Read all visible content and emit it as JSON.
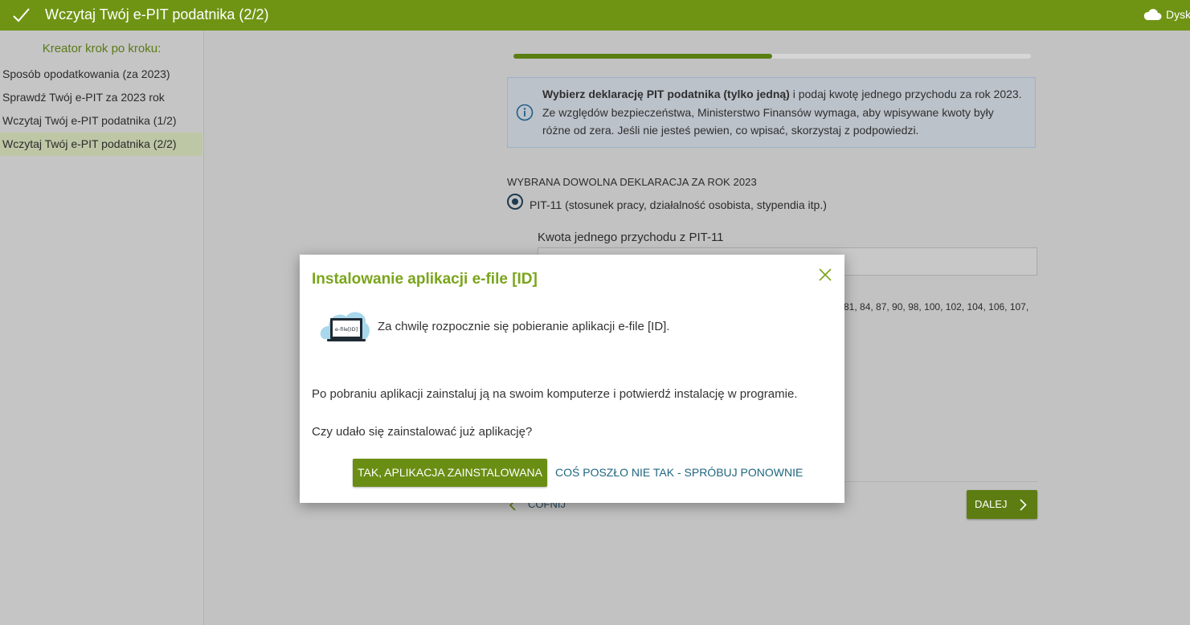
{
  "header": {
    "title": "Wczytaj Twój e-PIT podatnika (2/2)",
    "cloud_label": "Dysk",
    "check_icon": "checkmark-icon",
    "cloud_icon": "cloud-icon"
  },
  "sidebar": {
    "heading": "Kreator krok po kroku:",
    "items": [
      {
        "label": "Sposób opodatkowania (za 2023)"
      },
      {
        "label": "Sprawdź Twój e-PIT za 2023 rok"
      },
      {
        "label": "Wczytaj Twój e-PIT podatnika (1/2)"
      },
      {
        "label": "Wczytaj Twój e-PIT podatnika (2/2)",
        "active": true
      }
    ]
  },
  "main": {
    "progress": 0.5,
    "info": {
      "bold": "Wybierz deklarację PIT podatnika (tylko jedną)",
      "rest": " i podaj kwotę jednego przychodu za rok 2023. Ze względów bezpieczeństwa, Ministerstwo Finansów wymaga, aby wpisywane kwoty były różne od zera. Jeśli nie jesteś pewien, co wpisać, skorzystaj z podpowiedzi."
    },
    "section_label": "WYBRANA DOWOLNA DEKLARACJA ZA ROK 2023",
    "radio_label": "PIT-11 (stosunek pracy, działalność osobista, stypendia itp.)",
    "field_label": "Kwota jednego przychodu z PIT-11",
    "field_value": "",
    "hint_tail": "81, 84, 87, 90, 98, 100, 102, 104, 106, 107,",
    "back_label": "COFNIJ",
    "next_label": "DALEJ"
  },
  "modal": {
    "title": "Instalowanie aplikacji e-file [ID]",
    "line1": "Za chwilę rozpocznie się pobieranie aplikacji e-file [ID].",
    "line2": "Po pobraniu aplikacji zainstaluj ją na swoim komputerze i potwierdź instalację w programie.",
    "line3": "Czy udało się zainstalować już aplikację?",
    "confirm_button": "TAK, APLIKACJA ZAINSTALOWANA",
    "retry_button": "COŚ POSZŁO NIE TAK - SPRÓBUJ PONOWNIE",
    "app_icon_text": "e-file[ID]"
  },
  "colors": {
    "brand_green": "#6f9414",
    "modal_title": "#7aa51b",
    "link_blue": "#1f6680"
  }
}
